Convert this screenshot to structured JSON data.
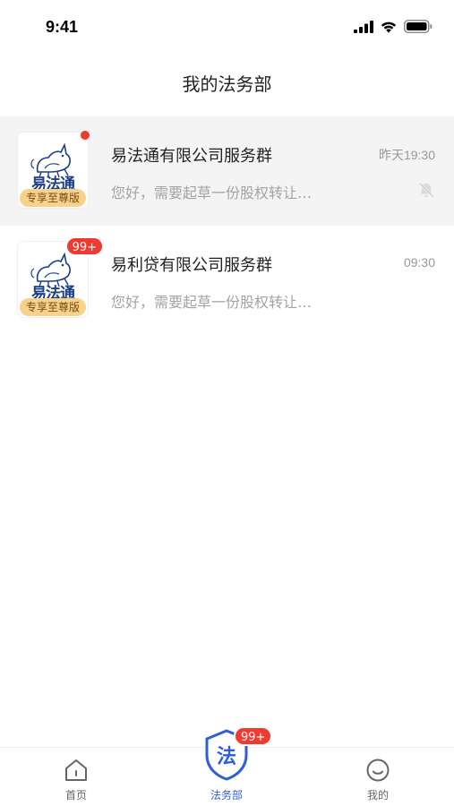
{
  "status_bar": {
    "time": "9:41",
    "signal_icon": "signal-icon",
    "wifi_icon": "wifi-icon",
    "battery_icon": "battery-icon"
  },
  "header": {
    "title": "我的法务部"
  },
  "chats": [
    {
      "name": "易法通有限公司服务群",
      "time": "昨天19:30",
      "preview": "您好，需要起草一份股权转让…",
      "avatar_brand": "易法通",
      "avatar_tag": "专享至尊版",
      "unread_dot": true,
      "muted": true
    },
    {
      "name": "易利贷有限公司服务群",
      "time": "09:30",
      "preview": "您好，需要起草一份股权转让…",
      "avatar_brand": "易法通",
      "avatar_tag": "专享至尊版",
      "unread_count": "99+",
      "muted": false
    }
  ],
  "tab_bar": {
    "tabs": [
      {
        "label": "首页",
        "icon": "home-icon",
        "active": false
      },
      {
        "label": "法务部",
        "icon": "law-shield-icon",
        "glyph": "法",
        "active": true,
        "badge": "99+"
      },
      {
        "label": "我的",
        "icon": "smile-icon",
        "active": false
      }
    ]
  },
  "colors": {
    "accent": "#2f5fd6",
    "badge": "#ee3a2f",
    "tag": "#f7d28a",
    "brand_blue": "#1b3f86"
  }
}
